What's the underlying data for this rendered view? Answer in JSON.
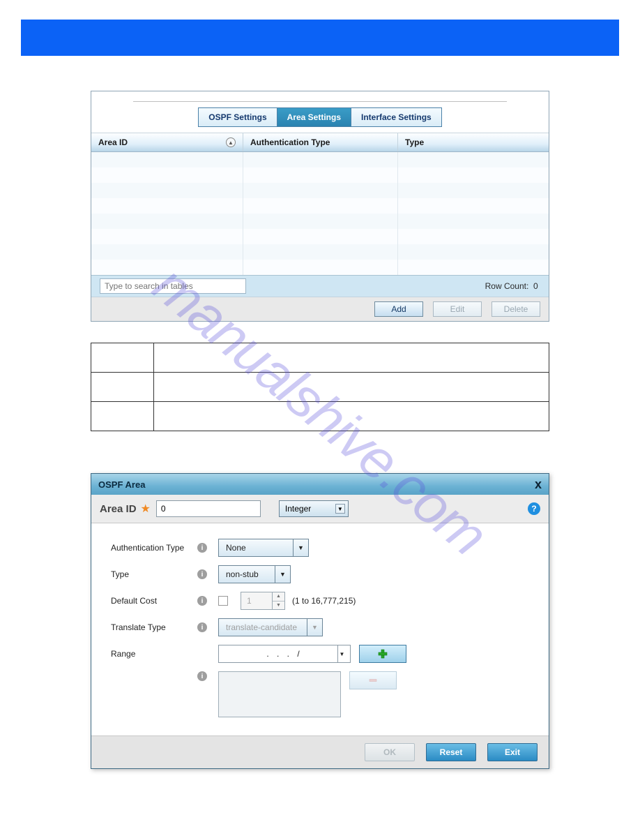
{
  "watermark": "manualshive.com",
  "tabs": {
    "ospf": "OSPF Settings",
    "area": "Area Settings",
    "iface": "Interface Settings"
  },
  "table": {
    "headers": {
      "area_id": "Area ID",
      "auth_type": "Authentication Type",
      "type": "Type"
    },
    "search_placeholder": "Type to search in tables",
    "row_count_label": "Row Count:",
    "row_count_value": "0",
    "buttons": {
      "add": "Add",
      "edit": "Edit",
      "delete": "Delete"
    }
  },
  "dialog": {
    "title": "OSPF Area",
    "close": "x",
    "area_id_label": "Area ID",
    "area_id_value": "0",
    "format_select": "Integer",
    "help": "?",
    "fields": {
      "auth_type": {
        "label": "Authentication Type",
        "value": "None"
      },
      "type": {
        "label": "Type",
        "value": "non-stub"
      },
      "default_cost": {
        "label": "Default Cost",
        "value": "1",
        "hint": "(1 to 16,777,215)"
      },
      "translate_type": {
        "label": "Translate Type",
        "value": "translate-candidate"
      },
      "range": {
        "label": "Range",
        "value": ".   .   .   /"
      }
    },
    "buttons": {
      "ok": "OK",
      "reset": "Reset",
      "exit": "Exit"
    }
  }
}
